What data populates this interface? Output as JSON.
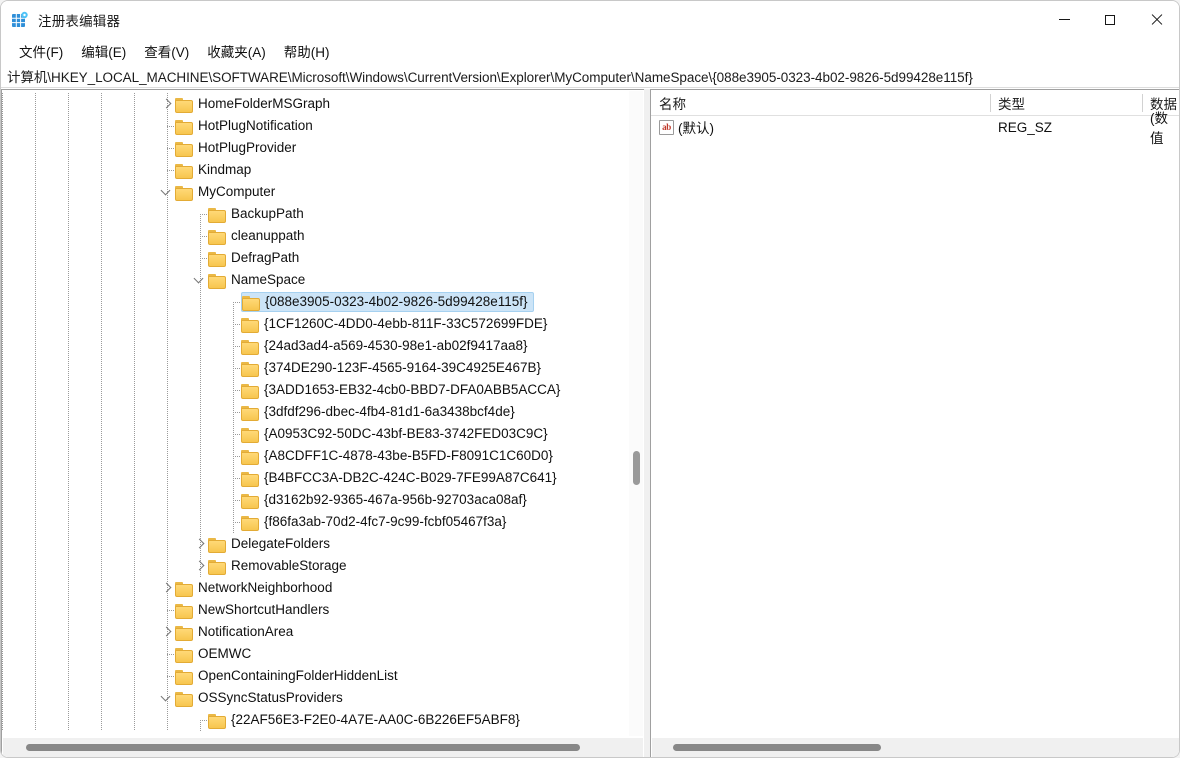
{
  "window": {
    "title": "注册表编辑器",
    "app_icon": "registry-editor-icon",
    "controls": {
      "minimize": "最小化",
      "maximize": "最大化",
      "close": "关闭"
    }
  },
  "menu": [
    {
      "label": "文件(F)",
      "name": "menu-file"
    },
    {
      "label": "编辑(E)",
      "name": "menu-edit"
    },
    {
      "label": "查看(V)",
      "name": "menu-view"
    },
    {
      "label": "收藏夹(A)",
      "name": "menu-favorites"
    },
    {
      "label": "帮助(H)",
      "name": "menu-help"
    }
  ],
  "address": {
    "path": "计算机\\HKEY_LOCAL_MACHINE\\SOFTWARE\\Microsoft\\Windows\\CurrentVersion\\Explorer\\MyComputer\\NameSpace\\{088e3905-0323-4b02-9826-5d99428e115f}"
  },
  "tree": {
    "nodes": [
      {
        "label": "HomeFolderMSGraph",
        "depth": 7,
        "chevron": "collapsed",
        "selected": false
      },
      {
        "label": "HotPlugNotification",
        "depth": 7,
        "chevron": "none",
        "selected": false
      },
      {
        "label": "HotPlugProvider",
        "depth": 7,
        "chevron": "none",
        "selected": false
      },
      {
        "label": "Kindmap",
        "depth": 7,
        "chevron": "none",
        "selected": false
      },
      {
        "label": "MyComputer",
        "depth": 7,
        "chevron": "expanded",
        "selected": false
      },
      {
        "label": "BackupPath",
        "depth": 8,
        "chevron": "none",
        "selected": false
      },
      {
        "label": "cleanuppath",
        "depth": 8,
        "chevron": "none",
        "selected": false
      },
      {
        "label": "DefragPath",
        "depth": 8,
        "chevron": "none",
        "selected": false
      },
      {
        "label": "NameSpace",
        "depth": 8,
        "chevron": "expanded",
        "selected": false
      },
      {
        "label": "{088e3905-0323-4b02-9826-5d99428e115f}",
        "depth": 9,
        "chevron": "none",
        "selected": true
      },
      {
        "label": "{1CF1260C-4DD0-4ebb-811F-33C572699FDE}",
        "depth": 9,
        "chevron": "none",
        "selected": false
      },
      {
        "label": "{24ad3ad4-a569-4530-98e1-ab02f9417aa8}",
        "depth": 9,
        "chevron": "none",
        "selected": false
      },
      {
        "label": "{374DE290-123F-4565-9164-39C4925E467B}",
        "depth": 9,
        "chevron": "none",
        "selected": false
      },
      {
        "label": "{3ADD1653-EB32-4cb0-BBD7-DFA0ABB5ACCA}",
        "depth": 9,
        "chevron": "none",
        "selected": false
      },
      {
        "label": "{3dfdf296-dbec-4fb4-81d1-6a3438bcf4de}",
        "depth": 9,
        "chevron": "none",
        "selected": false
      },
      {
        "label": "{A0953C92-50DC-43bf-BE83-3742FED03C9C}",
        "depth": 9,
        "chevron": "none",
        "selected": false
      },
      {
        "label": "{A8CDFF1C-4878-43be-B5FD-F8091C1C60D0}",
        "depth": 9,
        "chevron": "none",
        "selected": false
      },
      {
        "label": "{B4BFCC3A-DB2C-424C-B029-7FE99A87C641}",
        "depth": 9,
        "chevron": "none",
        "selected": false
      },
      {
        "label": "{d3162b92-9365-467a-956b-92703aca08af}",
        "depth": 9,
        "chevron": "none",
        "selected": false
      },
      {
        "label": "{f86fa3ab-70d2-4fc7-9c99-fcbf05467f3a}",
        "depth": 9,
        "chevron": "none",
        "selected": false
      },
      {
        "label": "DelegateFolders",
        "depth": 8,
        "chevron": "collapsed",
        "selected": false
      },
      {
        "label": "RemovableStorage",
        "depth": 8,
        "chevron": "collapsed",
        "selected": false
      },
      {
        "label": "NetworkNeighborhood",
        "depth": 7,
        "chevron": "collapsed",
        "selected": false
      },
      {
        "label": "NewShortcutHandlers",
        "depth": 7,
        "chevron": "none",
        "selected": false
      },
      {
        "label": "NotificationArea",
        "depth": 7,
        "chevron": "collapsed",
        "selected": false
      },
      {
        "label": "OEMWC",
        "depth": 7,
        "chevron": "none",
        "selected": false
      },
      {
        "label": "OpenContainingFolderHiddenList",
        "depth": 7,
        "chevron": "none",
        "selected": false
      },
      {
        "label": "OSSyncStatusProviders",
        "depth": 7,
        "chevron": "expanded",
        "selected": false
      },
      {
        "label": "{22AF56E3-F2E0-4A7E-AA0C-6B226EF5ABF8}",
        "depth": 8,
        "chevron": "none",
        "selected": false
      }
    ]
  },
  "values": {
    "columns": [
      {
        "label": "名称",
        "name": "column-name"
      },
      {
        "label": "类型",
        "name": "column-type"
      },
      {
        "label": "数据",
        "name": "column-data"
      }
    ],
    "rows": [
      {
        "name": "(默认)",
        "icon": "string-value-icon",
        "type": "REG_SZ",
        "data": "(数值"
      }
    ]
  },
  "colors": {
    "selection": "#cce4f7",
    "folder": "#f7c64f",
    "accent": "#0078d4"
  }
}
